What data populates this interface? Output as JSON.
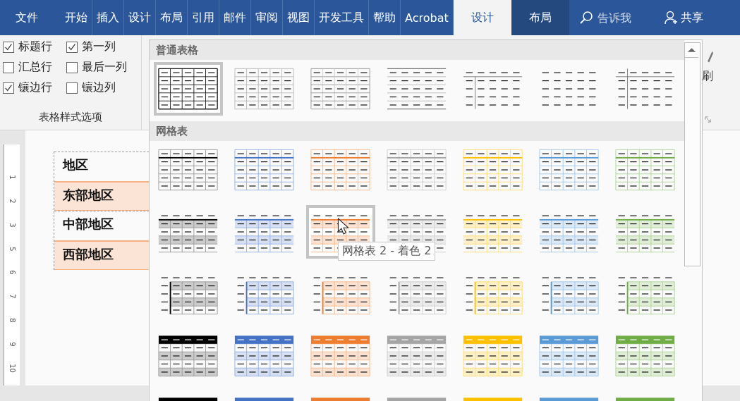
{
  "tabs": [
    {
      "label": "文件",
      "selected": false,
      "kind": "file"
    },
    {
      "label": "开始",
      "selected": false,
      "kind": "normal"
    },
    {
      "label": "插入",
      "selected": false,
      "kind": "normal"
    },
    {
      "label": "设计",
      "selected": false,
      "kind": "normal"
    },
    {
      "label": "布局",
      "selected": false,
      "kind": "normal"
    },
    {
      "label": "引用",
      "selected": false,
      "kind": "normal"
    },
    {
      "label": "邮件",
      "selected": false,
      "kind": "normal"
    },
    {
      "label": "审阅",
      "selected": false,
      "kind": "normal"
    },
    {
      "label": "视图",
      "selected": false,
      "kind": "normal"
    },
    {
      "label": "开发工具",
      "selected": false,
      "kind": "normal"
    },
    {
      "label": "帮助",
      "selected": false,
      "kind": "normal"
    },
    {
      "label": "Acrobat",
      "selected": false,
      "kind": "normal"
    },
    {
      "label": "设计",
      "selected": true,
      "kind": "context"
    },
    {
      "label": "布局",
      "selected": false,
      "kind": "context"
    }
  ],
  "search": {
    "placeholder": "告诉我"
  },
  "share": {
    "label": "共享"
  },
  "style_options": {
    "checkboxes": [
      {
        "label": "标题行",
        "checked": true
      },
      {
        "label": "第一列",
        "checked": true
      },
      {
        "label": "汇总行",
        "checked": false
      },
      {
        "label": "最后一列",
        "checked": false
      },
      {
        "label": "镶边行",
        "checked": true
      },
      {
        "label": "镶边列",
        "checked": false
      }
    ],
    "group_label": "表格样式选项"
  },
  "ribbon_right": {
    "label": "刷"
  },
  "gallery": {
    "sections": [
      {
        "title": "普通表格",
        "items": [
          {
            "kind": "plain1",
            "selected": true
          },
          {
            "kind": "plain2",
            "selected": false
          },
          {
            "kind": "plain3",
            "selected": false
          },
          {
            "kind": "plain4",
            "selected": false
          },
          {
            "kind": "plain5",
            "selected": false
          },
          {
            "kind": "plain6",
            "selected": false
          },
          {
            "kind": "plain7",
            "selected": false
          }
        ]
      },
      {
        "title": "网格表",
        "items": [
          {
            "kind": "grid1",
            "color": "#000000",
            "selected": false
          },
          {
            "kind": "grid1",
            "color": "#4472c4",
            "selected": false
          },
          {
            "kind": "grid1",
            "color": "#ed7d31",
            "selected": false
          },
          {
            "kind": "grid1",
            "color": "#a5a5a5",
            "selected": false
          },
          {
            "kind": "grid1",
            "color": "#ffc000",
            "selected": false
          },
          {
            "kind": "grid1",
            "color": "#5b9bd5",
            "selected": false
          },
          {
            "kind": "grid1",
            "color": "#70ad47",
            "selected": false
          },
          {
            "kind": "grid2",
            "color": "#000000",
            "selected": false
          },
          {
            "kind": "grid2",
            "color": "#4472c4",
            "selected": false
          },
          {
            "kind": "grid2",
            "color": "#ed7d31",
            "selected": true
          },
          {
            "kind": "grid2",
            "color": "#a5a5a5",
            "selected": false
          },
          {
            "kind": "grid2",
            "color": "#ffc000",
            "selected": false
          },
          {
            "kind": "grid2",
            "color": "#5b9bd5",
            "selected": false
          },
          {
            "kind": "grid2",
            "color": "#70ad47",
            "selected": false
          },
          {
            "kind": "grid3",
            "color": "#000000",
            "selected": false
          },
          {
            "kind": "grid3",
            "color": "#4472c4",
            "selected": false
          },
          {
            "kind": "grid3",
            "color": "#ed7d31",
            "selected": false
          },
          {
            "kind": "grid3",
            "color": "#a5a5a5",
            "selected": false
          },
          {
            "kind": "grid3",
            "color": "#ffc000",
            "selected": false
          },
          {
            "kind": "grid3",
            "color": "#5b9bd5",
            "selected": false
          },
          {
            "kind": "grid3",
            "color": "#70ad47",
            "selected": false
          },
          {
            "kind": "grid4",
            "color": "#000000",
            "selected": false
          },
          {
            "kind": "grid4",
            "color": "#4472c4",
            "selected": false
          },
          {
            "kind": "grid4",
            "color": "#ed7d31",
            "selected": false
          },
          {
            "kind": "grid4",
            "color": "#a5a5a5",
            "selected": false
          },
          {
            "kind": "grid4",
            "color": "#ffc000",
            "selected": false
          },
          {
            "kind": "grid4",
            "color": "#5b9bd5",
            "selected": false
          },
          {
            "kind": "grid4",
            "color": "#70ad47",
            "selected": false
          },
          {
            "kind": "grid5",
            "color": "#000000",
            "selected": false
          },
          {
            "kind": "grid5",
            "color": "#4472c4",
            "selected": false
          },
          {
            "kind": "grid5",
            "color": "#ed7d31",
            "selected": false
          },
          {
            "kind": "grid5",
            "color": "#a5a5a5",
            "selected": false
          },
          {
            "kind": "grid5",
            "color": "#ffc000",
            "selected": false
          },
          {
            "kind": "grid5",
            "color": "#5b9bd5",
            "selected": false
          },
          {
            "kind": "grid5",
            "color": "#70ad47",
            "selected": false
          }
        ]
      }
    ],
    "tooltip": "网格表 2 - 着色 2"
  },
  "ruler": [
    "1",
    "2",
    "3",
    "5",
    "6",
    "7",
    "8",
    "9",
    "10"
  ],
  "document_table": {
    "rows": [
      {
        "text": "地区",
        "shaded": false
      },
      {
        "text": "东部地区",
        "shaded": true
      },
      {
        "text": "中部地区",
        "shaded": false
      },
      {
        "text": "西部地区",
        "shaded": true
      }
    ]
  }
}
